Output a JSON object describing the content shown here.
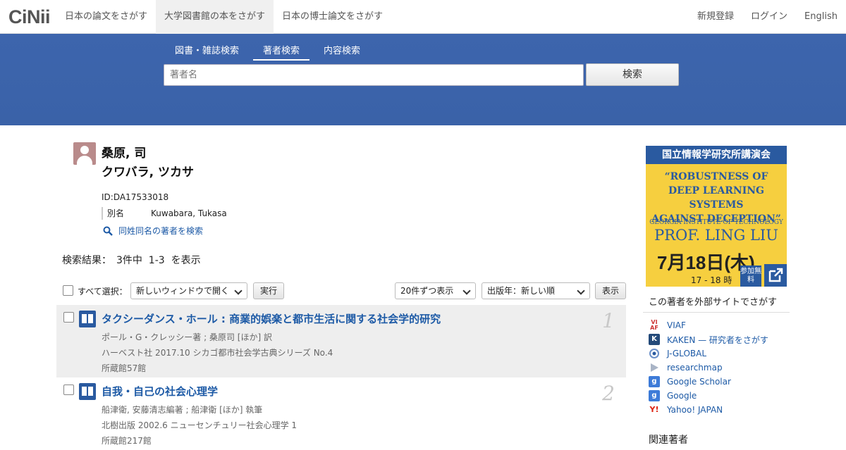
{
  "nav": {
    "logo": "CiNii",
    "tabs": [
      "日本の論文をさがす",
      "大学図書館の本をさがす",
      "日本の博士論文をさがす"
    ],
    "right": [
      "新規登録",
      "ログイン",
      "English"
    ]
  },
  "search": {
    "tabs": [
      "図書・雑誌検索",
      "著者検索",
      "内容検索"
    ],
    "placeholder": "著者名",
    "button": "検索"
  },
  "author": {
    "name": "桑原, 司",
    "kana": "クワバラ, ツカサ",
    "id": "ID:DA17533018",
    "alias_label": "別名",
    "alias_value": "Kuwabara, Tukasa",
    "same_name_link": "同姓同名の著者を検索"
  },
  "results": {
    "summary": "検索結果：　3件中  1-3  を表示",
    "select_all": "すべて選択：",
    "open_option": "新しいウィンドウで開く",
    "exec_button": "実行",
    "per_page": "20件ずつ表示",
    "sort": "出版年：新しい順",
    "show_button": "表示",
    "items": [
      {
        "num": "1",
        "title": "タクシーダンス・ホール : 商業的娯楽と都市生活に関する社会学的研究",
        "authors": "ポール・G・クレッシー著 ; 桑原司 [ほか] 訳",
        "pub": "ハーベスト社 2017.10 シカゴ都市社会学古典シリーズ No.4",
        "holdings": "所蔵館57館"
      },
      {
        "num": "2",
        "title": "自我・自己の社会心理学",
        "authors": "船津衛, 安藤清志編著 ; 船津衛 [ほか] 執筆",
        "pub": "北樹出版 2002.6 ニューセンチュリー社会心理学 1",
        "holdings": "所蔵館217館"
      }
    ]
  },
  "sidebar": {
    "banner": {
      "head": "国立情報学研究所講演会",
      "title_lines": [
        "“ROBUSTNESS OF",
        "DEEP LEARNING SYSTEMS",
        "AGAINST DECEPTION”"
      ],
      "org": "GEORGIA INSTITUTE OF TECHNOLOGY",
      "prof": "PROF. LING LIU",
      "date": "7月18日(木)",
      "time": "17 - 18 時",
      "free": "参加無料"
    },
    "ext_heading": "この著者を外部サイトでさがす",
    "ext_links": [
      "VIAF",
      "KAKEN — 研究者をさがす",
      "J-GLOBAL",
      "researchmap",
      "Google Scholar",
      "Google",
      "Yahoo! JAPAN"
    ],
    "related_heading": "関連著者"
  },
  "colors": {
    "brand_blue": "#3d65ad",
    "link": "#1d5aa6",
    "banner_yellow": "#f6cf3f"
  }
}
